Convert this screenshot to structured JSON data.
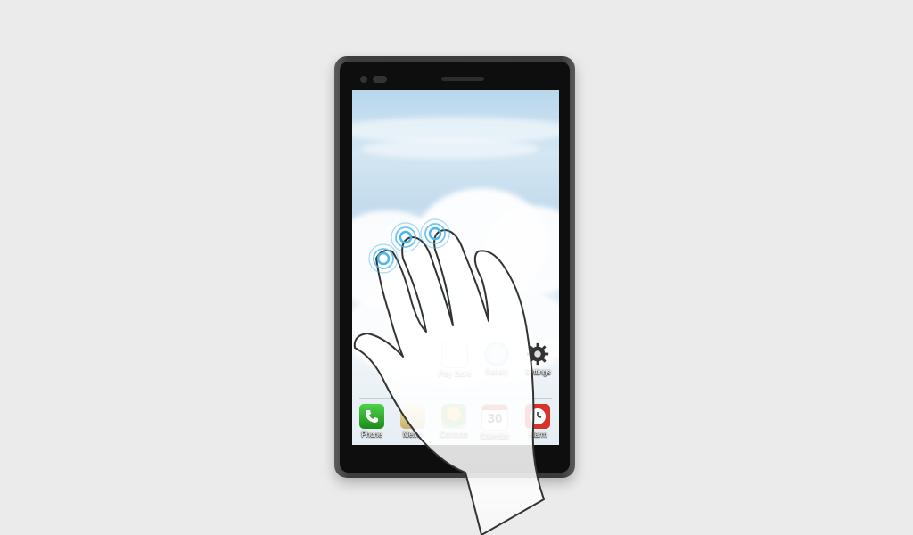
{
  "device": {
    "name": "smartphone"
  },
  "home_screen": {
    "wallpaper": "sky-clouds",
    "apps_row": [
      {
        "label": "Play Store",
        "icon": "play-store-icon"
      },
      {
        "label": "Gallery",
        "icon": "gallery-icon"
      },
      {
        "label": "Settings",
        "icon": "settings-gear-icon"
      }
    ],
    "dock": [
      {
        "label": "Phone",
        "icon": "phone-icon"
      },
      {
        "label": "Memo",
        "icon": "memo-icon"
      },
      {
        "label": "Contacts",
        "icon": "contacts-icon"
      },
      {
        "label": "Calendar",
        "icon": "calendar-icon",
        "date": "30"
      },
      {
        "label": "Alarm",
        "icon": "alarm-clock-icon"
      }
    ]
  },
  "gesture": {
    "type": "three-finger-touch",
    "touch_points": 3,
    "ripple_color": "#4bb6e8"
  },
  "colors": {
    "background": "#ebebeb",
    "phone_body": "#3d3d3d",
    "bezel": "#0e0e0e"
  }
}
